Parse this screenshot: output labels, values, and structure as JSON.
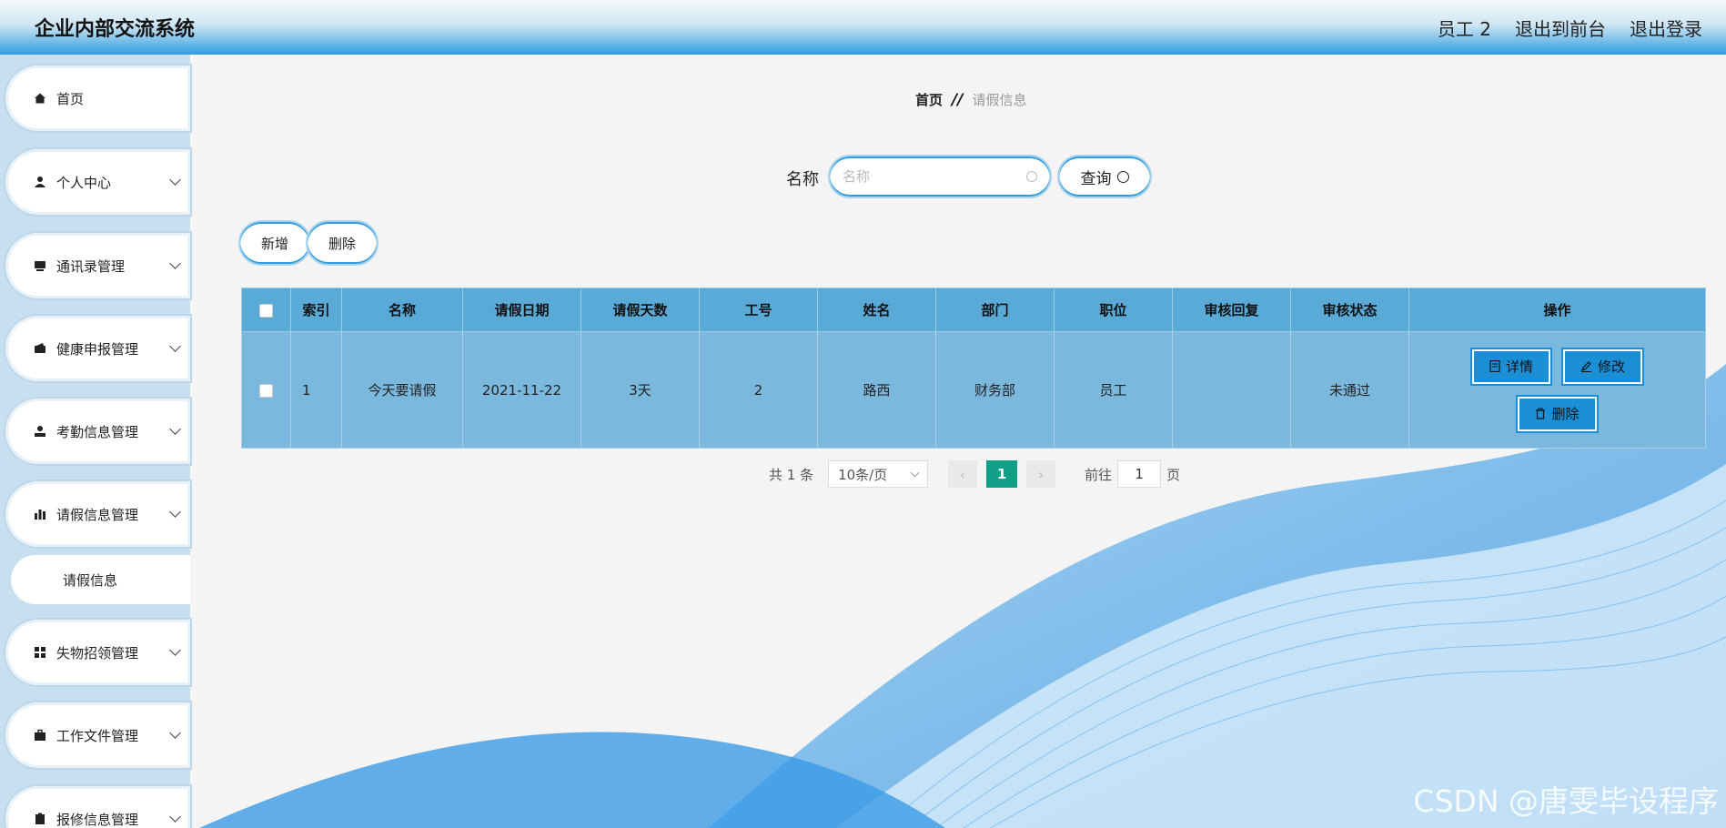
{
  "header": {
    "title": "企业内部交流系统",
    "user": "员工 2",
    "to_front": "退出到前台",
    "logout": "退出登录"
  },
  "sidebar": {
    "items": [
      {
        "label": "首页",
        "icon": "home-icon"
      },
      {
        "label": "个人中心",
        "icon": "user-icon"
      },
      {
        "label": "通讯录管理",
        "icon": "contacts-icon"
      },
      {
        "label": "健康申报管理",
        "icon": "wallet-icon"
      },
      {
        "label": "考勤信息管理",
        "icon": "person-icon"
      },
      {
        "label": "请假信息管理",
        "icon": "bar-chart-icon"
      },
      {
        "label": "失物招领管理",
        "icon": "grid-icon"
      },
      {
        "label": "工作文件管理",
        "icon": "briefcase-icon"
      },
      {
        "label": "报修信息管理",
        "icon": "clipboard-icon"
      }
    ],
    "sub_item": "请假信息"
  },
  "breadcrumb": {
    "home": "首页",
    "separator": "//",
    "current": "请假信息"
  },
  "search": {
    "label": "名称",
    "placeholder": "名称",
    "button": "查询"
  },
  "actions": {
    "add": "新增",
    "delete": "删除"
  },
  "table": {
    "columns": [
      "索引",
      "名称",
      "请假日期",
      "请假天数",
      "工号",
      "姓名",
      "部门",
      "职位",
      "审核回复",
      "审核状态",
      "操作"
    ],
    "rows": [
      {
        "index": "1",
        "name": "今天要请假",
        "date": "2021-11-22",
        "days": "3天",
        "emp_no": "2",
        "person": "路西",
        "dept": "财务部",
        "position": "员工",
        "reply": "",
        "status": "未通过",
        "ops": {
          "detail": "详情",
          "edit": "修改",
          "delete": "删除"
        }
      }
    ]
  },
  "pagination": {
    "total": "共 1 条",
    "page_size": "10条/页",
    "current_page": "1",
    "goto_label": "前往",
    "goto_value": "1",
    "page_suffix": "页"
  },
  "watermark": "CSDN @唐雯毕设程序",
  "colors": {
    "accent": "#2f9de0",
    "table_header": "#5aaad8",
    "table_row": "#7ab8dd",
    "page_active": "#109f86"
  }
}
